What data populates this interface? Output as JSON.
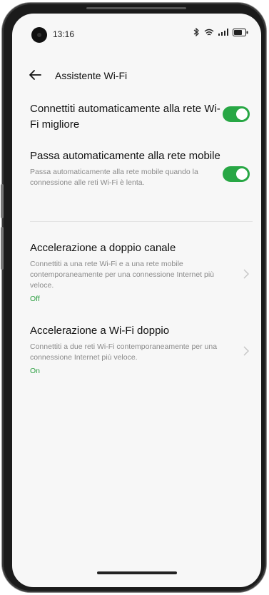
{
  "status_bar": {
    "time": "13:16",
    "icons": [
      "bluetooth-icon",
      "wifi-icon",
      "signal-icon",
      "battery-icon"
    ]
  },
  "header": {
    "back_icon": "arrow-left-icon",
    "title": "Assistente Wi-Fi"
  },
  "settings": {
    "auto_best_network": {
      "title": "Connettiti automaticamente alla rete Wi-Fi migliore",
      "enabled": true
    },
    "auto_mobile_switch": {
      "title": "Passa automaticamente alla rete mobile",
      "description": "Passa automaticamente alla rete mobile quando la connessione alle reti Wi-Fi è lenta.",
      "enabled": true
    },
    "dual_channel": {
      "title": "Accelerazione a doppio canale",
      "description": "Connettiti a una rete Wi-Fi e a una rete mobile contemporaneamente per una connessione Internet più veloce.",
      "status": "Off"
    },
    "dual_wifi": {
      "title": "Accelerazione a Wi-Fi doppio",
      "description": "Connettiti a due reti Wi-Fi contemporaneamente per una connessione Internet più veloce.",
      "status": "On"
    }
  },
  "colors": {
    "accent_green": "#28a745",
    "status_green": "#2ea043",
    "background": "#f7f7f7"
  }
}
